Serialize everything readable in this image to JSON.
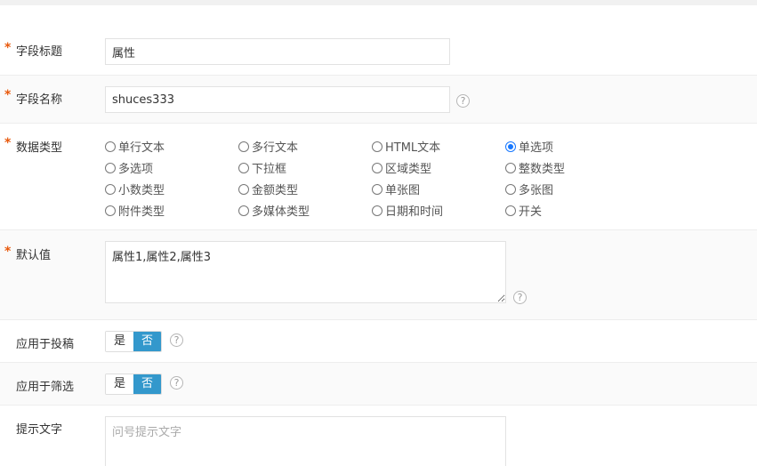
{
  "field_title": {
    "label": "字段标题",
    "required_mark": "*",
    "value": "属性"
  },
  "field_name": {
    "label": "字段名称",
    "required_mark": "*",
    "value": "shuces333",
    "help_icon": "?"
  },
  "data_type": {
    "label": "数据类型",
    "required_mark": "*",
    "selected": "单选项",
    "options": [
      "单行文本",
      "多行文本",
      "HTML文本",
      "单选项",
      "多选项",
      "下拉框",
      "区域类型",
      "整数类型",
      "小数类型",
      "金额类型",
      "单张图",
      "多张图",
      "附件类型",
      "多媒体类型",
      "日期和时间",
      "开关"
    ]
  },
  "default_value": {
    "label": "默认值",
    "required_mark": "*",
    "value": "属性1,属性2,属性3",
    "help_icon": "?"
  },
  "apply_submit": {
    "label": "应用于投稿",
    "yes": "是",
    "no": "否",
    "selected": "否",
    "help_icon": "?"
  },
  "apply_filter": {
    "label": "应用于筛选",
    "yes": "是",
    "no": "否",
    "selected": "否",
    "help_icon": "?"
  },
  "hint_text": {
    "label": "提示文字",
    "placeholder": "问号提示文字"
  },
  "colors": {
    "accent": "#3398cc",
    "required": "#e8590c",
    "radio_checked": "#1677ff"
  }
}
